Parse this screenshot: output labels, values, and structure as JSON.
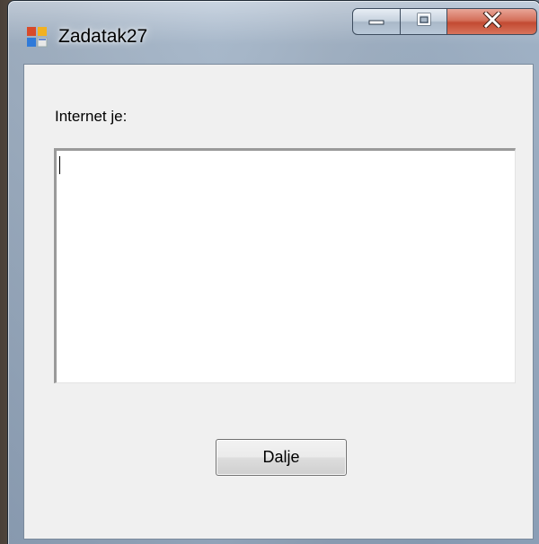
{
  "window": {
    "title": "Zadatak27",
    "icon": "winforms-app-icon"
  },
  "caption_buttons": {
    "minimize_icon": "minimize-icon",
    "maximize_icon": "maximize-icon",
    "close_icon": "close-icon"
  },
  "form": {
    "label": "Internet je:",
    "textbox_value": "",
    "button_label": "Dalje"
  },
  "colors": {
    "client_background": "#f0f0f0",
    "close_button": "#c24a32",
    "textbox_background": "#ffffff"
  }
}
